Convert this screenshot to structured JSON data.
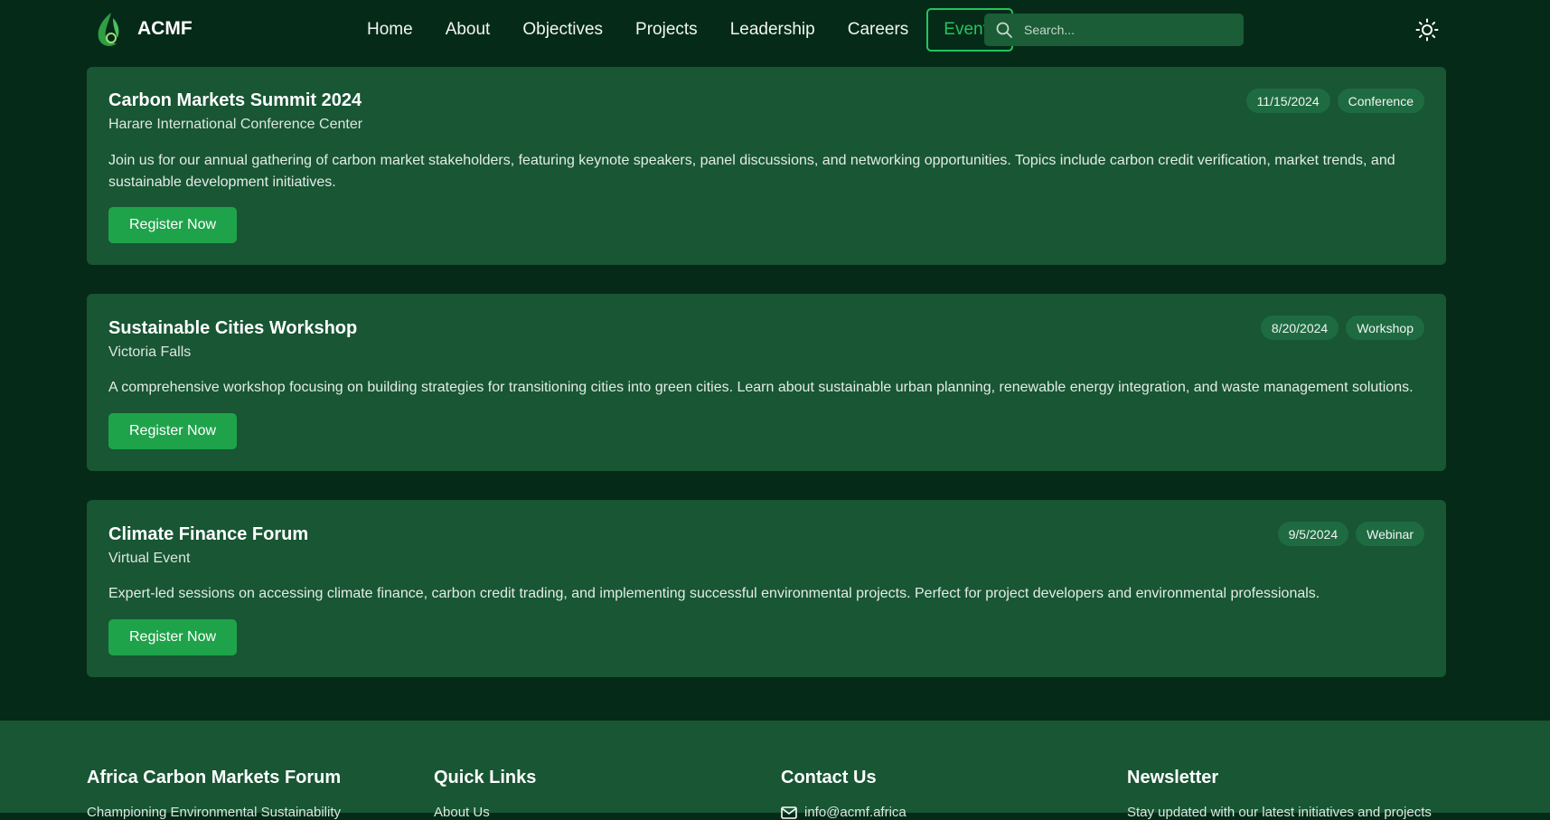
{
  "header": {
    "brand": "ACMF",
    "nav": [
      "Home",
      "About",
      "Objectives",
      "Projects",
      "Leadership",
      "Careers",
      "Events"
    ],
    "active": "Events",
    "search_placeholder": "Search..."
  },
  "events": [
    {
      "title": "Carbon Markets Summit 2024",
      "location": "Harare International Conference Center",
      "description": "Join us for our annual gathering of carbon market stakeholders, featuring keynote speakers, panel discussions, and networking opportunities. Topics include carbon credit verification, market trends, and sustainable development initiatives.",
      "date": "11/15/2024",
      "type": "Conference",
      "button": "Register Now"
    },
    {
      "title": "Sustainable Cities Workshop",
      "location": "Victoria Falls",
      "description": "A comprehensive workshop focusing on building strategies for transitioning cities into green cities. Learn about sustainable urban planning, renewable energy integration, and waste management solutions.",
      "date": "8/20/2024",
      "type": "Workshop",
      "button": "Register Now"
    },
    {
      "title": "Climate Finance Forum",
      "location": "Virtual Event",
      "description": "Expert-led sessions on accessing climate finance, carbon credit trading, and implementing successful environmental projects. Perfect for project developers and environmental professionals.",
      "date": "9/5/2024",
      "type": "Webinar",
      "button": "Register Now"
    }
  ],
  "footer": {
    "about_heading": "Africa Carbon Markets Forum",
    "about_text": "Championing Environmental Sustainability",
    "links_heading": "Quick Links",
    "links_first": "About Us",
    "contact_heading": "Contact Us",
    "contact_email": "info@acmf.africa",
    "newsletter_heading": "Newsletter",
    "newsletter_text": "Stay updated with our latest initiatives and projects"
  },
  "colors": {
    "background": "#062a18",
    "card": "#185634",
    "accent": "#22c55e",
    "button": "#1fa34a"
  }
}
